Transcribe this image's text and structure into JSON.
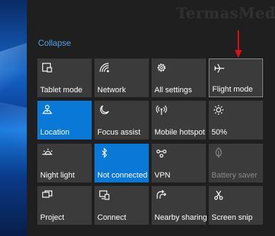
{
  "watermark": "TermasMedia",
  "collapse_label": "Collapse",
  "tiles": [
    {
      "label": "Tablet mode",
      "icon": "tablet-mode-icon",
      "state": "off"
    },
    {
      "label": "Network",
      "icon": "network-icon",
      "state": "off"
    },
    {
      "label": "All settings",
      "icon": "gear-icon",
      "state": "off"
    },
    {
      "label": "Flight mode",
      "icon": "airplane-icon",
      "state": "off"
    },
    {
      "label": "Location",
      "icon": "location-icon",
      "state": "on"
    },
    {
      "label": "Focus assist",
      "icon": "moon-icon",
      "state": "off"
    },
    {
      "label": "Mobile hotspot",
      "icon": "hotspot-icon",
      "state": "off"
    },
    {
      "label": "50%",
      "icon": "brightness-icon",
      "state": "off"
    },
    {
      "label": "Night light",
      "icon": "night-light-icon",
      "state": "off"
    },
    {
      "label": "Not connected",
      "icon": "bluetooth-icon",
      "state": "on"
    },
    {
      "label": "VPN",
      "icon": "vpn-icon",
      "state": "off"
    },
    {
      "label": "Battery saver",
      "icon": "leaf-icon",
      "state": "disabled"
    },
    {
      "label": "Project",
      "icon": "project-icon",
      "state": "off"
    },
    {
      "label": "Connect",
      "icon": "connect-icon",
      "state": "off"
    },
    {
      "label": "Nearby sharing",
      "icon": "share-icon",
      "state": "off"
    },
    {
      "label": "Screen snip",
      "icon": "screen-snip-icon",
      "state": "off"
    }
  ],
  "colors": {
    "accent": "#0a78d7",
    "tile": "#3b3b3b",
    "panel": "#1f1f1f",
    "link": "#5aa0e8",
    "annotation_arrow": "#e01010"
  }
}
